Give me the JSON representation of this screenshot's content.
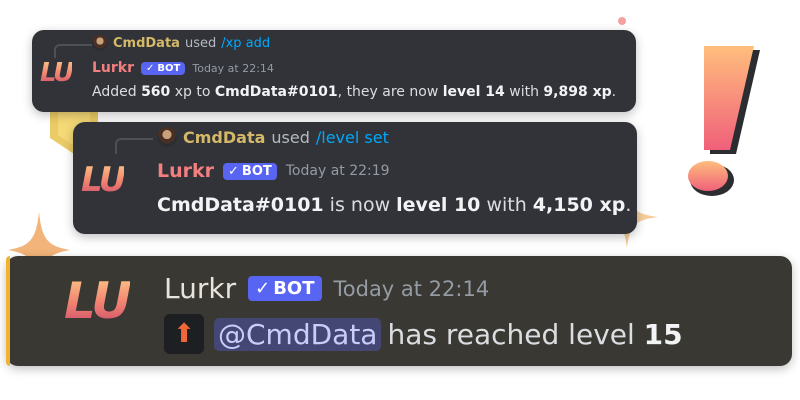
{
  "messages": [
    {
      "reply": {
        "user": "CmdData",
        "used": "used",
        "command": "/xp add"
      },
      "avatar_text": "LU",
      "author": "Lurkr",
      "badge": "BOT",
      "timestamp": "Today at 22:14",
      "content": {
        "prefix": "Added ",
        "xp": "560",
        "mid1": " xp to ",
        "target": "CmdData#0101",
        "mid2": ", they are now ",
        "level": "level 14",
        "mid3": " with ",
        "total": "9,898 xp",
        "end": "."
      }
    },
    {
      "reply": {
        "user": "CmdData",
        "used": "used",
        "command": "/level set"
      },
      "avatar_text": "LU",
      "author": "Lurkr",
      "badge": "BOT",
      "timestamp": "Today at 22:19",
      "content": {
        "target": "CmdData#0101",
        "mid1": " is now ",
        "level": "level 10",
        "mid2": " with ",
        "total": "4,150 xp",
        "end": "."
      }
    },
    {
      "avatar_text": "LU",
      "author": "Lurkr",
      "badge": "BOT",
      "timestamp": "Today at 22:14",
      "content": {
        "mention": "@CmdData",
        "text": " has reached level ",
        "level": "15"
      }
    }
  ],
  "icons": {
    "arrow": "up-arrow-icon",
    "check": "checkmark-icon",
    "exclaim": "exclamation-icon",
    "sparkle": "sparkle-icon",
    "gem": "gem-icon"
  },
  "colors": {
    "card_bg": "#313338",
    "highlight_bg": "#3a3832",
    "username": "#f47f7f",
    "bot_badge": "#5865f2",
    "command": "#00a8fc",
    "reply_name": "#d4b968"
  }
}
